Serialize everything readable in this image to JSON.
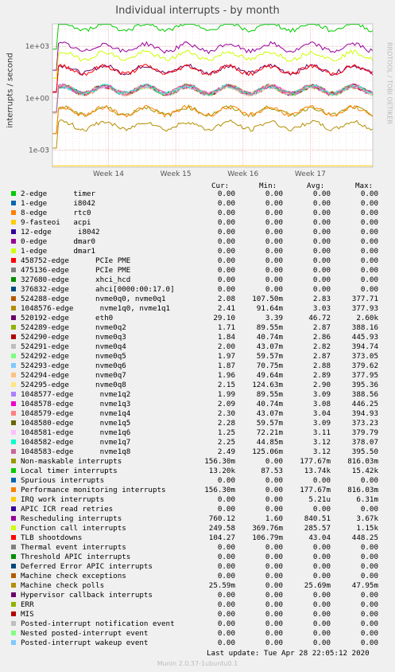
{
  "chart_data": {
    "type": "line",
    "title": "Individual interrupts - by month",
    "ylabel": "interrupts / second",
    "side_label": "RRDTOOL / TOBI OETIKER",
    "y_scale": "log",
    "ylim": [
      0.0001,
      20000
    ],
    "y_ticks": [
      {
        "value": 1000,
        "label": "1e+03"
      },
      {
        "value": 1,
        "label": "1e+00"
      },
      {
        "value": 0.001,
        "label": "1e-03"
      }
    ],
    "x_ticks": [
      "Week 14",
      "Week 15",
      "Week 16",
      "Week 17"
    ],
    "grid": true,
    "columns": [
      "Cur:",
      "Min:",
      "Avg:",
      "Max:"
    ],
    "series": [
      {
        "name": "2-edge      timer",
        "color": "#00cc00",
        "cur": "0.00",
        "min": "0.00",
        "avg": "0.00",
        "max": "0.00"
      },
      {
        "name": "1-edge      i8042",
        "color": "#0066b3",
        "cur": "0.00",
        "min": "0.00",
        "avg": "0.00",
        "max": "0.00"
      },
      {
        "name": "8-edge      rtc0",
        "color": "#ff8000",
        "cur": "0.00",
        "min": "0.00",
        "avg": "0.00",
        "max": "0.00"
      },
      {
        "name": "9-fasteoi   acpi",
        "color": "#ffcc00",
        "cur": "0.00",
        "min": "0.00",
        "avg": "0.00",
        "max": "0.00"
      },
      {
        "name": "12-edge      i8042",
        "color": "#330099",
        "cur": "0.00",
        "min": "0.00",
        "avg": "0.00",
        "max": "0.00"
      },
      {
        "name": "0-edge      dmar0",
        "color": "#990099",
        "cur": "0.00",
        "min": "0.00",
        "avg": "0.00",
        "max": "0.00"
      },
      {
        "name": "1-edge      dmar1",
        "color": "#ccff00",
        "cur": "0.00",
        "min": "0.00",
        "avg": "0.00",
        "max": "0.00"
      },
      {
        "name": "458752-edge      PCIe PME",
        "color": "#ff0000",
        "cur": "0.00",
        "min": "0.00",
        "avg": "0.00",
        "max": "0.00"
      },
      {
        "name": "475136-edge      PCIe PME",
        "color": "#808080",
        "cur": "0.00",
        "min": "0.00",
        "avg": "0.00",
        "max": "0.00"
      },
      {
        "name": "327680-edge      xhci_hcd",
        "color": "#008f00",
        "cur": "0.00",
        "min": "0.00",
        "avg": "0.00",
        "max": "0.00"
      },
      {
        "name": "376832-edge      ahci[0000:00:17.0]",
        "color": "#00487d",
        "cur": "0.00",
        "min": "0.00",
        "avg": "0.00",
        "max": "0.00"
      },
      {
        "name": "524288-edge      nvme0q0, nvme0q1",
        "color": "#b35a00",
        "cur": "2.08",
        "min": "107.50m",
        "avg": "2.83",
        "max": "377.71"
      },
      {
        "name": "1048576-edge      nvme1q0, nvme1q1",
        "color": "#b38f00",
        "cur": "2.41",
        "min": "91.64m",
        "avg": "3.03",
        "max": "377.93"
      },
      {
        "name": "520192-edge      eth0",
        "color": "#6b006b",
        "cur": "29.10",
        "min": "3.39",
        "avg": "46.72",
        "max": "2.60k"
      },
      {
        "name": "524289-edge      nvme0q2",
        "color": "#8fb300",
        "cur": "1.71",
        "min": "89.55m",
        "avg": "2.87",
        "max": "388.16"
      },
      {
        "name": "524290-edge      nvme0q3",
        "color": "#b30000",
        "cur": "1.84",
        "min": "40.74m",
        "avg": "2.86",
        "max": "445.93"
      },
      {
        "name": "524291-edge      nvme0q4",
        "color": "#bebebe",
        "cur": "2.00",
        "min": "43.07m",
        "avg": "2.82",
        "max": "394.74"
      },
      {
        "name": "524292-edge      nvme0q5",
        "color": "#80ff80",
        "cur": "1.97",
        "min": "59.57m",
        "avg": "2.87",
        "max": "373.05"
      },
      {
        "name": "524293-edge      nvme0q6",
        "color": "#80c9ff",
        "cur": "1.87",
        "min": "70.75m",
        "avg": "2.88",
        "max": "379.62"
      },
      {
        "name": "524294-edge      nvme0q7",
        "color": "#ffc080",
        "cur": "1.96",
        "min": "49.64m",
        "avg": "2.89",
        "max": "377.95"
      },
      {
        "name": "524295-edge      nvme0q8",
        "color": "#ffe680",
        "cur": "2.15",
        "min": "124.63m",
        "avg": "2.90",
        "max": "395.36"
      },
      {
        "name": "1048577-edge      nvme1q2",
        "color": "#aa80ff",
        "cur": "1.99",
        "min": "89.55m",
        "avg": "3.09",
        "max": "388.56"
      },
      {
        "name": "1048578-edge      nvme1q3",
        "color": "#ee00cc",
        "cur": "2.09",
        "min": "40.74m",
        "avg": "3.08",
        "max": "446.25"
      },
      {
        "name": "1048579-edge      nvme1q4",
        "color": "#ff8080",
        "cur": "2.30",
        "min": "43.07m",
        "avg": "3.04",
        "max": "394.93"
      },
      {
        "name": "1048580-edge      nvme1q5",
        "color": "#666600",
        "cur": "2.28",
        "min": "59.57m",
        "avg": "3.09",
        "max": "373.23"
      },
      {
        "name": "1048581-edge      nvme1q6",
        "color": "#ffbfff",
        "cur": "1.25",
        "min": "72.21m",
        "avg": "3.11",
        "max": "379.79"
      },
      {
        "name": "1048582-edge      nvme1q7",
        "color": "#00ffcc",
        "cur": "2.25",
        "min": "44.85m",
        "avg": "3.12",
        "max": "378.07"
      },
      {
        "name": "1048583-edge      nvme1q8",
        "color": "#cc6699",
        "cur": "2.49",
        "min": "125.06m",
        "avg": "3.12",
        "max": "395.50"
      },
      {
        "name": "Non-maskable interrupts",
        "color": "#999900",
        "cur": "156.30m",
        "min": "0.00",
        "avg": "177.67m",
        "max": "816.03m"
      },
      {
        "name": "Local timer interrupts",
        "color": "#00cc00",
        "cur": "13.20k",
        "min": "87.53",
        "avg": "13.74k",
        "max": "15.42k"
      },
      {
        "name": "Spurious interrupts",
        "color": "#0066b3",
        "cur": "0.00",
        "min": "0.00",
        "avg": "0.00",
        "max": "0.00"
      },
      {
        "name": "Performance monitoring interrupts",
        "color": "#ff8000",
        "cur": "156.30m",
        "min": "0.00",
        "avg": "177.67m",
        "max": "816.03m"
      },
      {
        "name": "IRQ work interrupts",
        "color": "#ffcc00",
        "cur": "0.00",
        "min": "0.00",
        "avg": "5.21u",
        "max": "6.31m"
      },
      {
        "name": "APIC ICR read retries",
        "color": "#330099",
        "cur": "0.00",
        "min": "0.00",
        "avg": "0.00",
        "max": "0.00"
      },
      {
        "name": "Rescheduling interrupts",
        "color": "#990099",
        "cur": "760.12",
        "min": "1.60",
        "avg": "840.51",
        "max": "3.67k"
      },
      {
        "name": "Function call interrupts",
        "color": "#ccff00",
        "cur": "249.58",
        "min": "369.76m",
        "avg": "285.57",
        "max": "1.15k"
      },
      {
        "name": "TLB shootdowns",
        "color": "#ff0000",
        "cur": "104.27",
        "min": "106.79m",
        "avg": "43.04",
        "max": "448.25"
      },
      {
        "name": "Thermal event interrupts",
        "color": "#808080",
        "cur": "0.00",
        "min": "0.00",
        "avg": "0.00",
        "max": "0.00"
      },
      {
        "name": "Threshold APIC interrupts",
        "color": "#008f00",
        "cur": "0.00",
        "min": "0.00",
        "avg": "0.00",
        "max": "0.00"
      },
      {
        "name": "Deferred Error APIC interrupts",
        "color": "#00487d",
        "cur": "0.00",
        "min": "0.00",
        "avg": "0.00",
        "max": "0.00"
      },
      {
        "name": "Machine check exceptions",
        "color": "#b35a00",
        "cur": "0.00",
        "min": "0.00",
        "avg": "0.00",
        "max": "0.00"
      },
      {
        "name": "Machine check polls",
        "color": "#b38f00",
        "cur": "25.59m",
        "min": "0.00",
        "avg": "25.69m",
        "max": "47.95m"
      },
      {
        "name": "Hypervisor callback interrupts",
        "color": "#6b006b",
        "cur": "0.00",
        "min": "0.00",
        "avg": "0.00",
        "max": "0.00"
      },
      {
        "name": "ERR",
        "color": "#8fb300",
        "cur": "0.00",
        "min": "0.00",
        "avg": "0.00",
        "max": "0.00"
      },
      {
        "name": "MIS",
        "color": "#b30000",
        "cur": "0.00",
        "min": "0.00",
        "avg": "0.00",
        "max": "0.00"
      },
      {
        "name": "Posted-interrupt notification event",
        "color": "#bebebe",
        "cur": "0.00",
        "min": "0.00",
        "avg": "0.00",
        "max": "0.00"
      },
      {
        "name": "Nested posted-interrupt event",
        "color": "#80ff80",
        "cur": "0.00",
        "min": "0.00",
        "avg": "0.00",
        "max": "0.00"
      },
      {
        "name": "Posted-interrupt wakeup event",
        "color": "#80c9ff",
        "cur": "0.00",
        "min": "0.00",
        "avg": "0.00",
        "max": "0.00"
      }
    ]
  },
  "footer": {
    "last_update": "Last update:  Tue Apr 28 22:05:12 2020",
    "munin": "Munin 2.0.37-1ubuntu0.1"
  }
}
